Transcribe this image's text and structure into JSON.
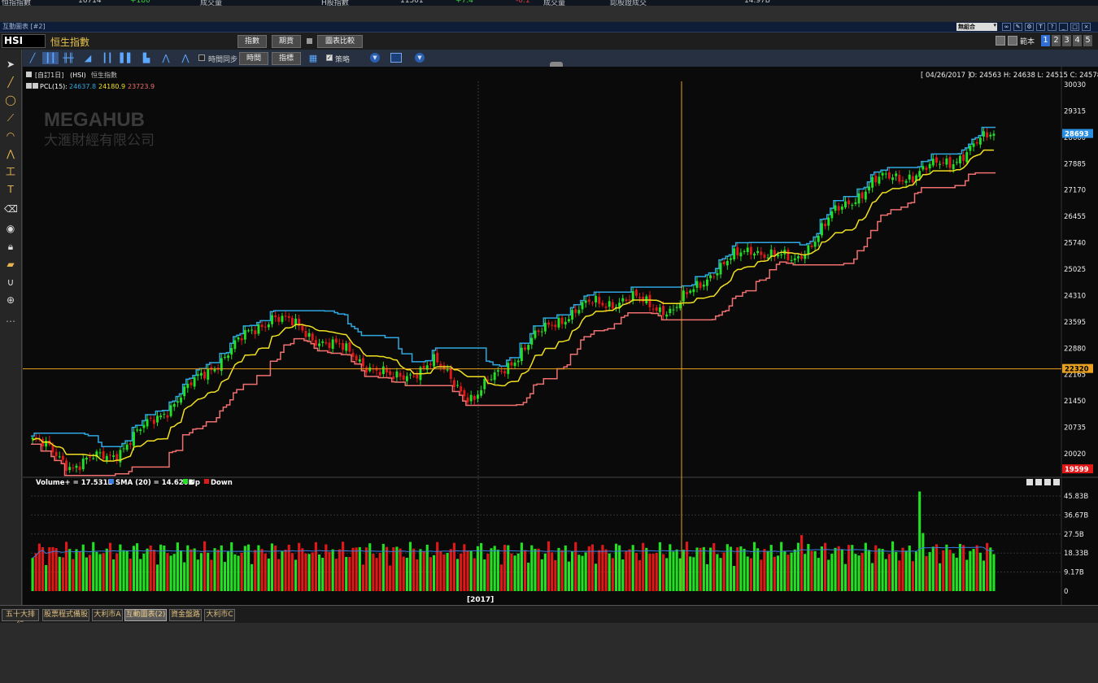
{
  "window": {
    "title": "互動圖表 [#2]",
    "portfolio_select": "無組合"
  },
  "symbol": {
    "code": "HSI",
    "name": "恒生指數"
  },
  "header_buttons": [
    "指數",
    "期貨",
    "圖表比較"
  ],
  "template": {
    "label": "範本",
    "tabs": [
      "1",
      "2",
      "3",
      "4",
      "5"
    ],
    "active": "1"
  },
  "toolbar": {
    "sync_time_label": "時間同步",
    "period_button": "時間",
    "indicator_button": "指標",
    "strategy_label": "策略",
    "strategy_checked": true
  },
  "chart_header": {
    "period": "[自訂1日]",
    "code": "(HSI)",
    "name": "恒生指數",
    "date": "[ 04/26/2017 ]",
    "ohlc": "O: 24563  H: 24638  L: 24515  C: 24578"
  },
  "pcl_legend": {
    "label": "PCL(15):",
    "upper": "24637.8",
    "mid": "24180.9",
    "lower": "23723.9"
  },
  "watermark": {
    "en": "MEGAHUB",
    "zh": "大滙財經有限公司"
  },
  "price_axis": [
    "30030",
    "29315",
    "28600",
    "27885",
    "27170",
    "26455",
    "25740",
    "25025",
    "24310",
    "23595",
    "22880",
    "22165",
    "21450",
    "20735",
    "20020"
  ],
  "price_tags": {
    "last": "28693",
    "crosshair": "22320",
    "low": "19599"
  },
  "volume_legend": {
    "label": "Volume+ = 17.531B",
    "sma": "SMA (20) = 14.620B",
    "up": "Up",
    "down": "Down"
  },
  "volume_axis": [
    "45.83B",
    "36.67B",
    "27.5B",
    "18.33B",
    "9.17B",
    "0"
  ],
  "x_label": "[2017]",
  "bottom_tabs": [
    "五十大排行",
    "股票程式備股",
    "大利市A",
    "互動圖表(2)",
    "資金盤路",
    "大利市C"
  ],
  "bottom_active": 3,
  "colors": {
    "up": "#22e022",
    "down": "#e01818",
    "upper_band": "#2fa7e0",
    "mid_band": "#f0e020",
    "lower_band": "#f07070",
    "accent": "#e8a020"
  },
  "chart_data": {
    "type": "line",
    "title": "",
    "series": [
      {
        "name": "",
        "values": [
          20400,
          19700,
          20000,
          20900,
          21900,
          22900,
          23800,
          23200,
          22700,
          22000,
          22500,
          21500,
          22600,
          23600,
          24100,
          24200,
          23900,
          25000,
          25600,
          25200,
          26500,
          27400,
          27600,
          28000,
          28700
        ]
      }
    ],
    "ylim": [
      19599,
      30030
    ]
  }
}
